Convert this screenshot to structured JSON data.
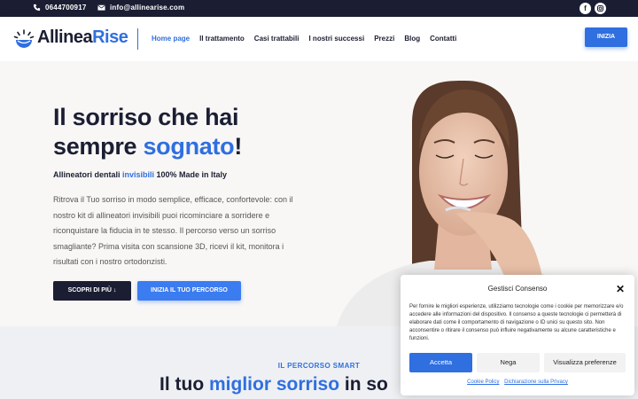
{
  "topbar": {
    "phone": "0644700917",
    "email": "info@allinearise.com",
    "social": [
      "facebook-icon",
      "instagram-icon"
    ]
  },
  "header": {
    "logo": {
      "part1": "Allinea",
      "part2": "Rise"
    },
    "nav": [
      "Home page",
      "Il trattamento",
      "Casi trattabili",
      "I nostri successi",
      "Prezzi",
      "Blog",
      "Contatti"
    ],
    "active_nav": "Home page",
    "cta": "INIZIA"
  },
  "hero": {
    "title_line1": "Il sorriso che hai",
    "title_line2_pre": "sempre ",
    "title_line2_hl": "sognato",
    "title_line2_post": "!",
    "subtitle_pre": "Allineatori dentali ",
    "subtitle_hl": "invisibili",
    "subtitle_post": " 100% Made in Italy",
    "body": "Ritrova il Tuo sorriso in modo semplice, efficace, confortevole: con il nostro kit di allineatori invisibili puoi ricominciare a sorridere e riconquistare la fiducia in te stesso. Il percorso verso un sorriso smagliante? Prima visita con scansione 3D, ricevi il kit, monitora i risultati con i nostro ortodonzisti.",
    "btn_primary": "SCOPRI DI PIÙ ↓",
    "btn_secondary": "INIZIA IL TUO PERCORSO"
  },
  "lower": {
    "kicker": "IL PERCORSO SMART",
    "title_pre": "Il tuo ",
    "title_hl": "miglior sorriso",
    "title_post": " in so"
  },
  "cookie": {
    "title": "Gestisci Consenso",
    "text": "Per fornire le migliori esperienze, utilizziamo tecnologie come i cookie per memorizzare e/o accedere alle informazioni del dispositivo. Il consenso a queste tecnologie ci permetterà di elaborare dati come il comportamento di navigazione o ID unici su questo sito. Non acconsentire o ritirare il consenso può influire negativamente su alcune caratteristiche e funzioni.",
    "accept": "Accetta",
    "deny": "Nega",
    "prefs": "Visualizza preferenze",
    "link1": "Cookie Policy",
    "link2": "Dichiarazione sulla Privacy"
  },
  "colors": {
    "brand_blue": "#2f6fe0",
    "navy": "#1b1e33"
  }
}
